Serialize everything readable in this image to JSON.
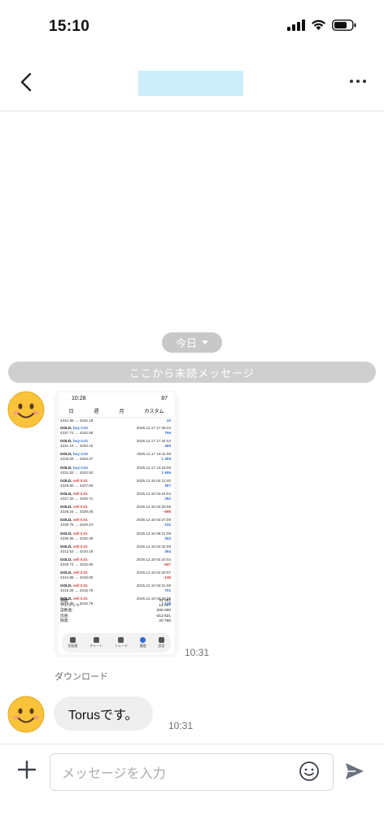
{
  "status_bar": {
    "time": "15:10"
  },
  "date_separator": "今日",
  "unread_banner": "ここから未読メッセージ",
  "screenshot": {
    "time": "10:28",
    "battery": "87",
    "tabs": [
      "日",
      "週",
      "月",
      "カスタム"
    ],
    "first_partial": {
      "price": "4342.89 → 4342.18",
      "value": "23"
    },
    "trades": [
      {
        "sym": "GOLD,",
        "side": "buy 0.01",
        "type": "buy",
        "price": "4337.72 → 4342.58",
        "date": "2025.12.17 17:36:04",
        "pnl": "756"
      },
      {
        "sym": "GOLD,",
        "side": "buy 0.01",
        "type": "buy",
        "price": "4331.16 → 4334.15",
        "date": "2025.12.17 17:44:04",
        "pnl": "465"
      },
      {
        "sym": "GOLD,",
        "side": "buy 0.01",
        "type": "buy",
        "price": "4325.06 → 4334.27",
        "date": "2025.12.17 18:11:09",
        "pnl": "1 305"
      },
      {
        "sym": "GOLD,",
        "side": "buy 0.01",
        "type": "buy",
        "price": "4331.83 → 4342.50",
        "date": "2025.12.17 13:18:09",
        "pnl": "1 659"
      },
      {
        "sym": "GOLD,",
        "side": "sell 0.01",
        "type": "sell",
        "price": "4329.80 → 4327.83",
        "date": "2025.12.18 02:12:40",
        "pnl": "307"
      },
      {
        "sym": "GOLD,",
        "side": "sell 0.01",
        "type": "sell",
        "price": "4327.33 → 4325.71",
        "date": "2025.12.18 03:16:04",
        "pnl": "252"
      },
      {
        "sym": "GOLD,",
        "side": "sell 0.01",
        "type": "sell",
        "price": "4325.24 → 4329.06",
        "date": "2025.12.18 03:20:06",
        "pnl": "-595"
      },
      {
        "sym": "GOLD,",
        "side": "sell 0.01",
        "type": "sell",
        "price": "4330.75 → 4329.24",
        "date": "2025.12.18 03:27:08",
        "pnl": "232"
      },
      {
        "sym": "GOLD,",
        "side": "sell 0.01",
        "type": "sell",
        "price": "4335.98 → 4332.39",
        "date": "2025.12.18 08:21:09",
        "pnl": "343"
      },
      {
        "sym": "GOLD,",
        "side": "sell 0.01",
        "type": "sell",
        "price": "4312.53 → 4310.19",
        "date": "2025.12.19 02:32:09",
        "pnl": "364"
      },
      {
        "sym": "GOLD,",
        "side": "sell 0.01",
        "type": "sell",
        "price": "4329.72 → 4315.80",
        "date": "2025.12.19 03:20:04",
        "pnl": "-947"
      },
      {
        "sym": "GOLD,",
        "side": "sell 0.01",
        "type": "sell",
        "price": "4314.85 → 4315.80",
        "date": "2025.12.19 03:30:07",
        "pnl": "-148"
      },
      {
        "sym": "GOLD,",
        "side": "sell 0.01",
        "type": "sell",
        "price": "4315.28 → 4315.78",
        "date": "2025.12.19 03:31:09",
        "pnl": "701"
      },
      {
        "sym": "GOLD,",
        "side": "sell 0.01",
        "type": "sell",
        "price": "4326.35 → 4315.79",
        "date": "2025.12.19 03:45:08",
        "pnl": "1 145"
      }
    ],
    "summary": [
      {
        "label": "損益:",
        "value": "31 381"
      },
      {
        "label": "クレジット:",
        "value": "14 017"
      },
      {
        "label": "証拠金:",
        "value": "200 000"
      },
      {
        "label": "出金:",
        "value": "-312 621"
      },
      {
        "label": "残高:",
        "value": "20 760"
      }
    ],
    "bottom_nav": [
      "気配値",
      "チャート",
      "トレード",
      "履歴",
      "設定"
    ]
  },
  "image_message_time": "10:31",
  "download_label": "ダウンロード",
  "text_message": "Torusです。",
  "text_message_time": "10:31",
  "input": {
    "placeholder": "メッセージを入力"
  }
}
